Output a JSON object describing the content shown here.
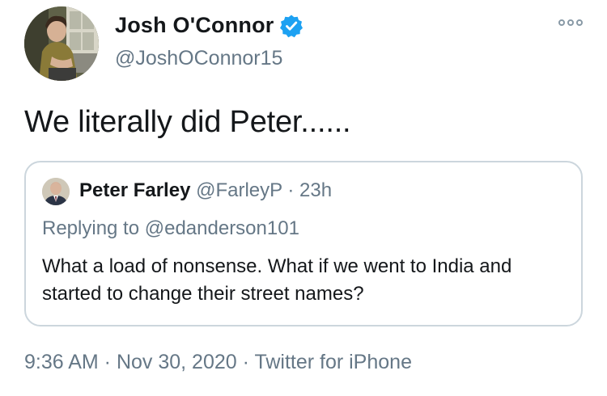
{
  "tweet": {
    "author": {
      "display_name": "Josh O'Connor",
      "handle": "@JoshOConnor15",
      "verified": true
    },
    "text": "We literally did Peter......",
    "more_icon": "more-options-icon",
    "timestamp": {
      "time": "9:36 AM",
      "separator1": " · ",
      "date": "Nov 30, 2020",
      "separator2": " · ",
      "source": "Twitter for iPhone"
    }
  },
  "quoted_tweet": {
    "display_name": "Peter Farley",
    "handle": "@FarleyP",
    "meta_separator": " · ",
    "age": "23h",
    "replying_to": "Replying to @edanderson101",
    "text": "What a load of nonsense. What if we went to India and started to change their street names?"
  },
  "colors": {
    "verified_blue": "#1da1f2",
    "secondary_text": "#657786",
    "border": "#ccd6dd"
  }
}
